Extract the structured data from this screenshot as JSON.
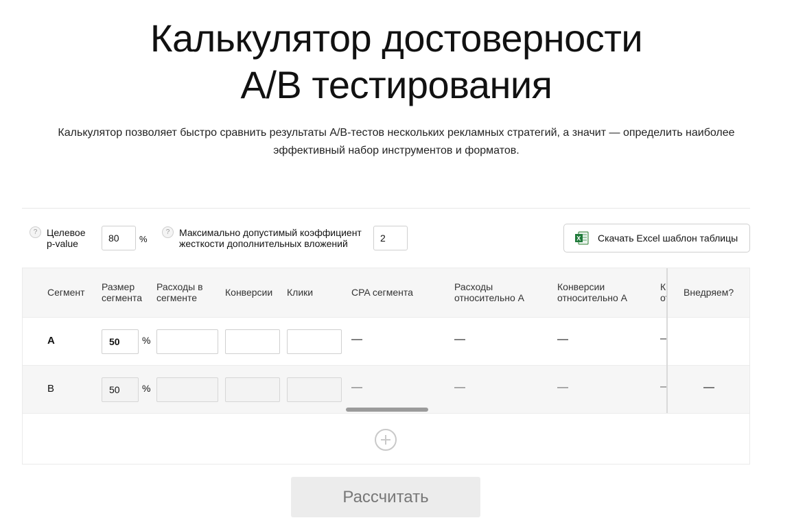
{
  "page": {
    "title_line1": "Калькулятор достоверности",
    "title_line2": "A/B тестирования",
    "subtitle": "Калькулятор позволяет быстро сравнить результаты A/B-тестов нескольких рекламных стратегий, а значит — определить наиболее эффективный набор инструментов и форматов."
  },
  "params": {
    "help_glyph": "?",
    "pvalue_label_line1": "Целевое",
    "pvalue_label_line2": "p-value",
    "pvalue_value": "80",
    "pvalue_unit": "%",
    "coef_label_line1": "Максимально допустимый коэффициент",
    "coef_label_line2": "жесткости дополнительных вложений",
    "coef_value": "2",
    "excel_button": "Скачать Excel шаблон таблицы",
    "excel_icon_letter": "X"
  },
  "table": {
    "headers": {
      "segment": "Сегмент",
      "size_line1": "Размер",
      "size_line2": "сегмента",
      "spend_line1": "Расходы в",
      "spend_line2": "сегменте",
      "conversions": "Конверсии",
      "clicks": "Клики",
      "cpa": "CPA сегмента",
      "spend_rel_line1": "Расходы",
      "spend_rel_line2": "относительно А",
      "conv_rel_line1": "Конверсии",
      "conv_rel_line2": "относительно А",
      "clipped_line1": "К",
      "clipped_line2": "от",
      "implement": "Внедряем?"
    },
    "rows": [
      {
        "segment": "A",
        "size": "50",
        "unit": "%",
        "spend": "",
        "conversions": "",
        "clicks": "",
        "cpa": "—",
        "spend_rel": "—",
        "conv_rel": "—",
        "clipped": "—",
        "implement": ""
      },
      {
        "segment": "B",
        "size": "50",
        "unit": "%",
        "spend": "",
        "conversions": "",
        "clicks": "",
        "cpa": "—",
        "spend_rel": "—",
        "conv_rel": "—",
        "clipped": "—",
        "implement": "—"
      }
    ]
  },
  "actions": {
    "calculate": "Рассчитать"
  }
}
